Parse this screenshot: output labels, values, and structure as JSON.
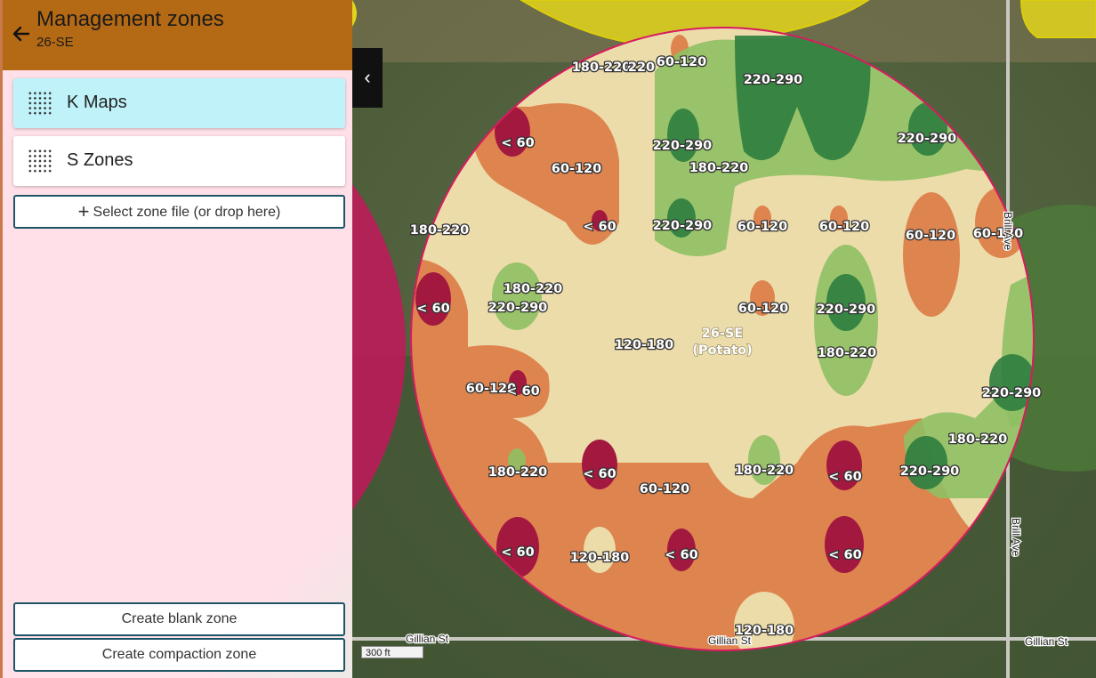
{
  "header": {
    "title": "Management zones",
    "subtitle": "26-SE",
    "back_icon": "arrow-left-icon"
  },
  "zone_cards": [
    {
      "label": "K Maps",
      "icon": "dot-grid-icon",
      "selected": true,
      "color": "#bff3f9"
    },
    {
      "label": "S Zones",
      "icon": "dot-grid-icon",
      "selected": false,
      "color": "#ffffff"
    }
  ],
  "select_file": {
    "label": "Select zone file (or drop here)",
    "icon": "plus-icon"
  },
  "buttons": {
    "create_blank": "Create blank zone",
    "create_compaction": "Create compaction zone"
  },
  "map": {
    "collapse_icon": "chevron-left-icon",
    "field_name": "26-SE",
    "crop": "(Potato)",
    "scale_label": "300 ft",
    "roads": {
      "gillian_1": "Gillian St",
      "gillian_2": "Gillian St",
      "gillian_3": "Gillian St",
      "brill_1": "Brill Ave",
      "brill_2": "Brill Ave"
    },
    "legend_colors": {
      "< 60": "#a3183f",
      "60-120": "#dd7a45",
      "120-180": "#ecdcaa",
      "180-220": "#8fc063",
      "220-290": "#2e7d3f"
    },
    "zone_labels": [
      "180-220",
      "220-290",
      "220",
      "60-120",
      "220-290",
      "< 60",
      "60-120",
      "220-290",
      "180-220",
      "220-290",
      "180-220",
      "< 60",
      "220-290",
      "60-120",
      "60-120",
      "60-120",
      "60-120",
      "< 60",
      "180-220",
      "220-290",
      "60-120",
      "220-290",
      "120-180",
      "180-220",
      "60-120",
      "< 60",
      "220-290",
      "180-220",
      "180-220",
      "< 60",
      "180-220",
      "< 60",
      "220-290",
      "60-120",
      "< 60",
      "120-180",
      "< 60",
      "< 60",
      "120-180"
    ]
  }
}
